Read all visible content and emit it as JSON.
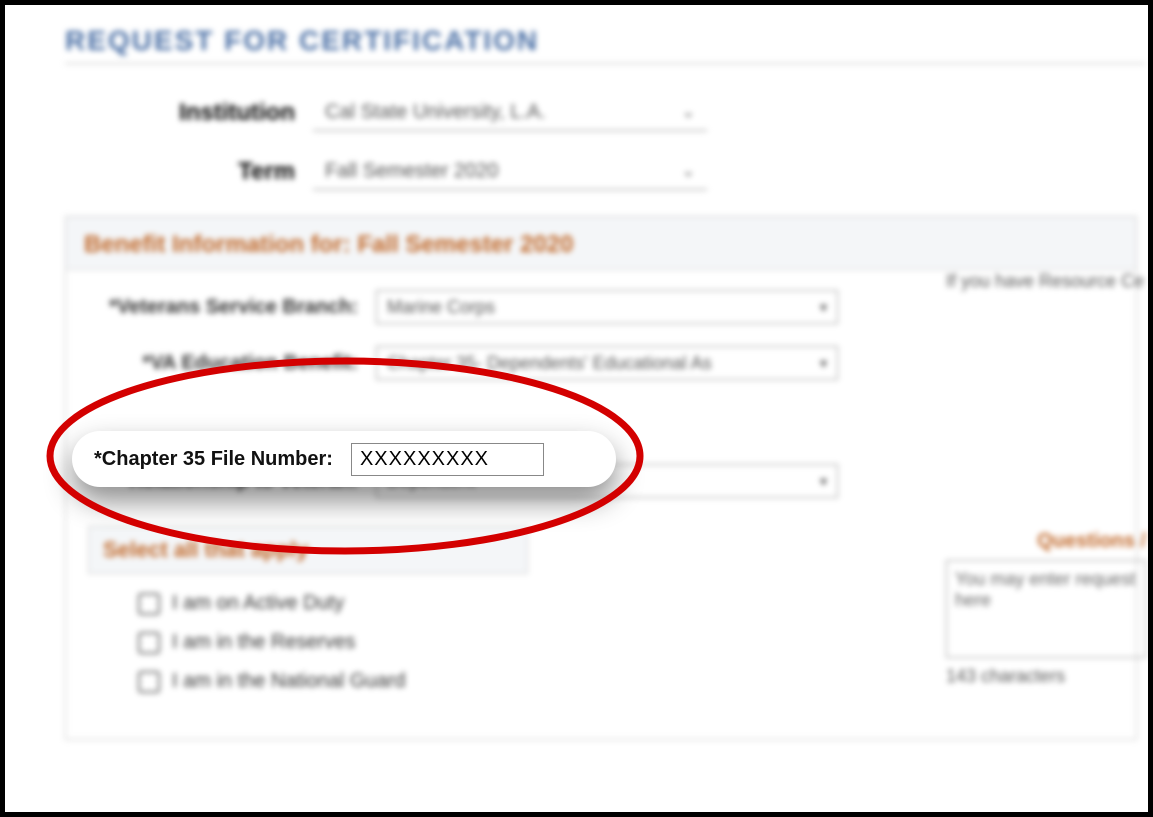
{
  "page_title": "REQUEST FOR CERTIFICATION",
  "institution": {
    "label": "Institution",
    "value": "Cal State University, L.A."
  },
  "term": {
    "label": "Term",
    "value": "Fall Semester 2020"
  },
  "panel_title": "Benefit Information for: Fall Semester 2020",
  "fields": {
    "branch": {
      "label": "*Veterans Service Branch:",
      "value": "Marine Corps"
    },
    "benefit": {
      "label": "*VA Education Benefit:",
      "value": "Chapter 35- Dependents' Educational As"
    },
    "file_no": {
      "label": "*Chapter 35 File Number:",
      "value": "XXXXXXXXX"
    },
    "relation": {
      "label": "*Relationship to Veteran:",
      "value": "Dependent"
    }
  },
  "side_note": "If you have\nResource Ce",
  "select_all_header": "Select all that apply",
  "checks": {
    "active_duty": "I am on Active Duty",
    "reserves": "I am in the Reserves",
    "national_guard": "I am in the National Guard"
  },
  "questions_header": "Questions / ",
  "textarea_text": "You may enter\nrequest here",
  "char_count": "143 characters"
}
